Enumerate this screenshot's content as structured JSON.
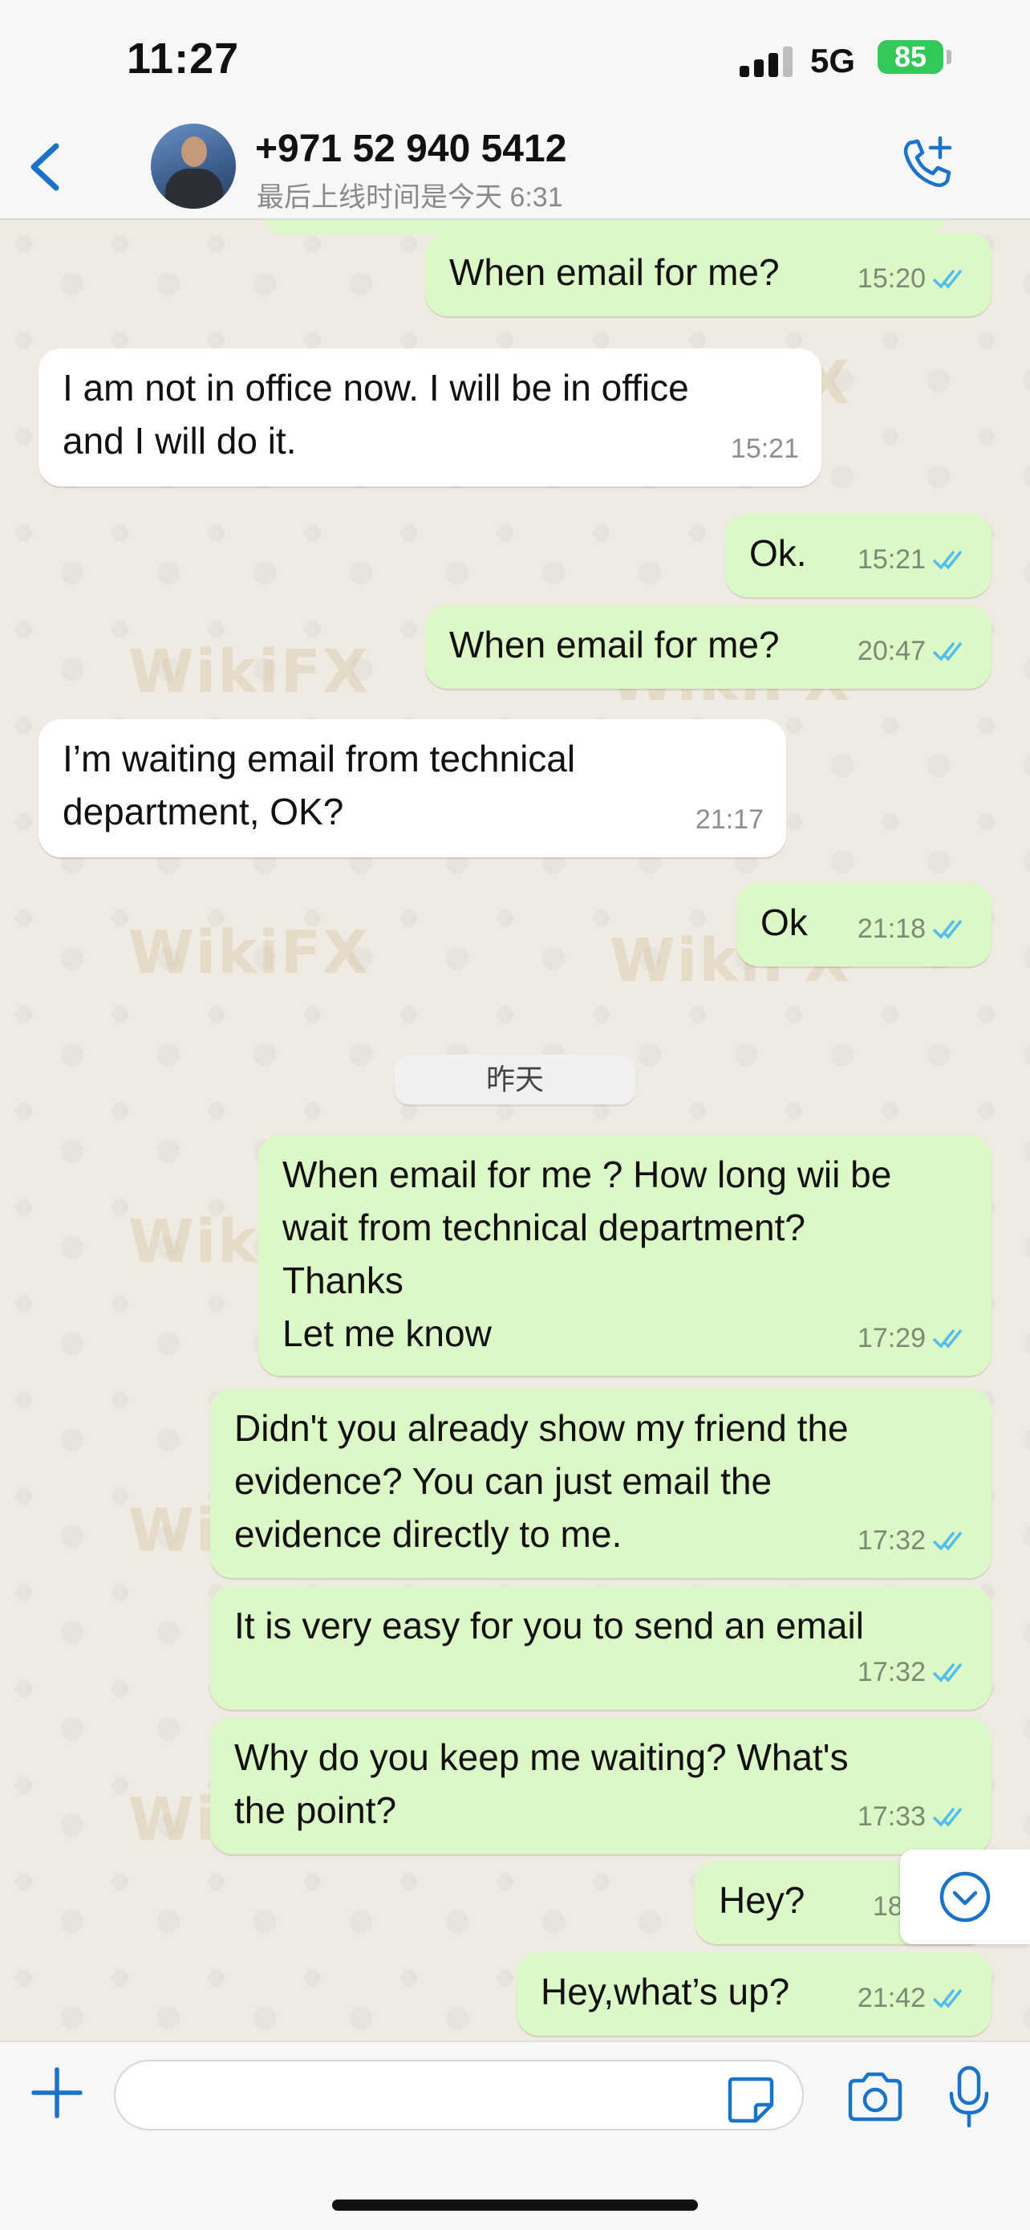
{
  "status_bar": {
    "time": "11:27",
    "network": "5G",
    "battery": "85"
  },
  "header": {
    "contact_name": "+971 52 940 5412",
    "last_seen": "最后上线时间是今天 6:31"
  },
  "watermark_text": "WikiFX",
  "colors": {
    "outgoing_bubble": "#dcf8c6",
    "incoming_bubble": "#ffffff",
    "chat_background": "#efeae2",
    "accent": "#1a73c8",
    "read_ticks": "#53bdeb"
  },
  "day_separator": "昨天",
  "messages": [
    {
      "dir": "out",
      "text": "When email for me?",
      "time": "15:20",
      "read": true
    },
    {
      "dir": "in",
      "text": "I am not in office now. I will be in office\nand I will do it.",
      "time": "15:21"
    },
    {
      "dir": "out",
      "text": "Ok.",
      "time": "15:21",
      "read": true
    },
    {
      "dir": "out",
      "text": "When email for me?",
      "time": "20:47",
      "read": true
    },
    {
      "dir": "in",
      "text": "I’m waiting email from technical\ndepartment, OK?",
      "time": "21:17"
    },
    {
      "dir": "out",
      "text": "Ok",
      "time": "21:18",
      "read": true
    },
    {
      "dir": "out",
      "text": "When email for me ? How long wii be\nwait from technical department?\nThanks\nLet me know",
      "time": "17:29",
      "read": true
    },
    {
      "dir": "out",
      "text": "Didn't you already show my friend the\nevidence? You can just email the\nevidence directly to me.",
      "time": "17:32",
      "read": true
    },
    {
      "dir": "out",
      "text": "It is very easy for you to send an email",
      "time": "17:32",
      "read": true
    },
    {
      "dir": "out",
      "text": "Why do you keep me waiting? What's\nthe point?",
      "time": "17:33",
      "read": true
    },
    {
      "dir": "out",
      "text": "Hey?",
      "time": "18:3",
      "read": true
    },
    {
      "dir": "out",
      "text": "Hey,what’s up?",
      "time": "21:42",
      "read": true
    }
  ],
  "icons": {
    "back": "chevron-left-icon",
    "call": "phone-plus-icon",
    "scroll": "chevron-down-circle-icon",
    "attach": "plus-icon",
    "sticker": "sticker-icon",
    "camera": "camera-icon",
    "mic": "microphone-icon"
  }
}
